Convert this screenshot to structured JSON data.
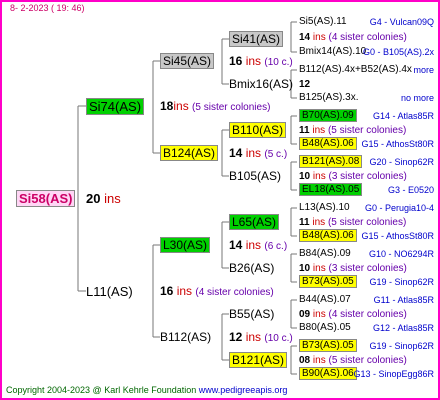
{
  "header": {
    "date": "8-  2-2023  ( 19: 46)"
  },
  "watermark": "",
  "root": {
    "name": "Si58(AS)",
    "ins_count": "20",
    "ins_word": "ins"
  },
  "gen2": [
    {
      "name": "Si74(AS)",
      "ins_count": "18",
      "ins_word": "ins",
      "sisters": "(5 sister colonies)"
    },
    {
      "name": "L11(AS)",
      "ins_count": "16",
      "ins_word": "ins",
      "sisters": "(4 sister colonies)"
    }
  ],
  "gen3": [
    {
      "name": "Si45(AS)",
      "ins_count": "16",
      "ins_word": "ins",
      "sisters": "(10 c.)"
    },
    {
      "name": "B124(AS)",
      "ins_count": "14",
      "ins_word": "ins",
      "sisters": "(5 c.)"
    },
    {
      "name": "L30(AS)",
      "ins_count": "14",
      "ins_word": "ins",
      "sisters": "(6 c.)"
    },
    {
      "name": "B112(AS)",
      "ins_count": "12",
      "ins_word": "ins",
      "sisters": "(10 c.)"
    }
  ],
  "gen4": [
    {
      "name": "Si41(AS)",
      "ins_count": "14",
      "ins_word": "ins",
      "sisters": "(4 sister colonies)"
    },
    {
      "name": "Bmix16(AS)",
      "ins_count": "12",
      "ins_word": "",
      "sisters": ""
    },
    {
      "name": "B110(AS)",
      "ins_count": "11",
      "ins_word": "ins",
      "sisters": "(5 sister colonies)"
    },
    {
      "name": "B105(AS)",
      "ins_count": "10",
      "ins_word": "ins",
      "sisters": "(3 sister colonies)"
    },
    {
      "name": "L65(AS)",
      "ins_count": "11",
      "ins_word": "ins",
      "sisters": "(5 sister colonies)"
    },
    {
      "name": "B26(AS)",
      "ins_count": "10",
      "ins_word": "ins",
      "sisters": "(3 sister colonies)"
    },
    {
      "name": "B55(AS)",
      "ins_count": "09",
      "ins_word": "ins",
      "sisters": "(4 sister colonies)"
    },
    {
      "name": "B121(AS)",
      "ins_count": "08",
      "ins_word": "ins",
      "sisters": "(5 sister colonies)"
    }
  ],
  "gen5": [
    {
      "name": "Si5(AS).11",
      "hl": "",
      "info": "G4 - Vulcan09Q"
    },
    {
      "name": "Bmix14(AS).10",
      "hl": "",
      "info": "G0 - B105(AS).2x"
    },
    {
      "name": "B112(AS).4x+B52(AS).4x",
      "hl": "",
      "info": "more"
    },
    {
      "name": "B125(AS).3x.",
      "hl": "",
      "info": "no more"
    },
    {
      "name": "B70(AS).09",
      "hl": "green",
      "info": "G14 - Atlas85R"
    },
    {
      "name": "B48(AS).06",
      "hl": "yellow",
      "info": "G15 - AthosSt80R"
    },
    {
      "name": "B121(AS).08",
      "hl": "yellow",
      "info": "G20 - Sinop62R"
    },
    {
      "name": "EL18(AS).05",
      "hl": "green",
      "info": "G3 - E0520"
    },
    {
      "name": "L13(AS).10",
      "hl": "",
      "info": "G0 - Perugia10-4"
    },
    {
      "name": "B48(AS).06",
      "hl": "yellow",
      "info": "G15 - AthosSt80R"
    },
    {
      "name": "B84(AS).09",
      "hl": "",
      "info": "G10 - NO6294R"
    },
    {
      "name": "B73(AS).05",
      "hl": "yellow",
      "info": "G19 - Sinop62R"
    },
    {
      "name": "B44(AS).07",
      "hl": "",
      "info": "G11 - Atlas85R"
    },
    {
      "name": "B80(AS).05",
      "hl": "",
      "info": "G12 - Atlas85R"
    },
    {
      "name": "B73(AS).05",
      "hl": "yellow",
      "info": "G19 - Sinop62R"
    },
    {
      "name": "B90(AS).06",
      "hl": "yellow",
      "info": "G13 - SinopEgg86R"
    }
  ],
  "footer": {
    "copyright": "Copyright 2004-2023 @ Karl Kehrle Foundation",
    "site": "www.pedigreeapis.org"
  }
}
